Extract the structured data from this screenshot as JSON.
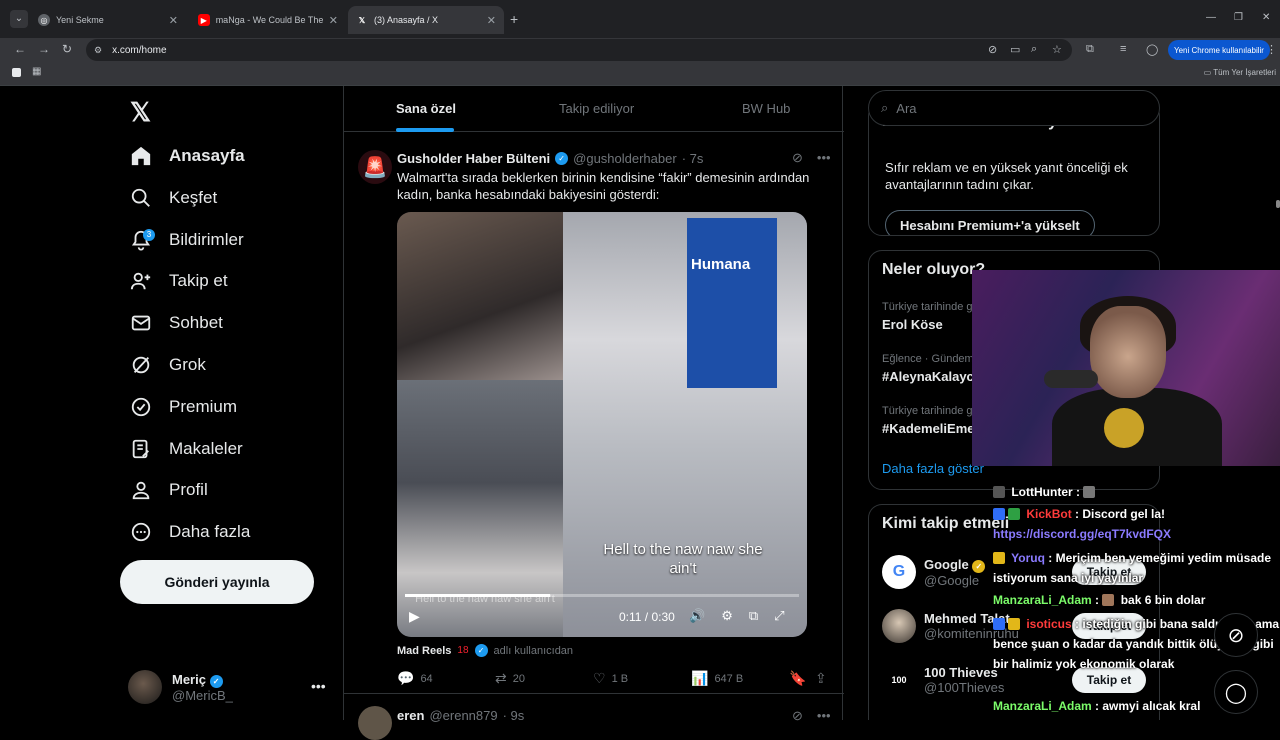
{
  "browser": {
    "tabs": [
      {
        "title": "Yeni Sekme"
      },
      {
        "title": "maNga - We Could Be The Sam"
      },
      {
        "title": "(3) Anasayfa / X"
      }
    ],
    "url": "x.com/home",
    "update_button": "Yeni Chrome kullanılabilir",
    "bookmarks_all": "Tüm Yer İşaretleri"
  },
  "nav": {
    "items": [
      {
        "label": "Anasayfa"
      },
      {
        "label": "Keşfet"
      },
      {
        "label": "Bildirimler",
        "badge": "3"
      },
      {
        "label": "Takip et"
      },
      {
        "label": "Sohbet"
      },
      {
        "label": "Grok"
      },
      {
        "label": "Premium"
      },
      {
        "label": "Makaleler"
      },
      {
        "label": "Profil"
      },
      {
        "label": "Daha fazla"
      }
    ],
    "post_button": "Gönderi yayınla",
    "account": {
      "name": "Meriç",
      "handle": "@MericB_"
    }
  },
  "timeline": {
    "tabs": [
      {
        "label": "Sana özel"
      },
      {
        "label": "Takip ediliyor"
      },
      {
        "label": "BW Hub"
      }
    ],
    "tweet": {
      "name": "Gusholder Haber Bülteni",
      "handle": "@gusholderhaber",
      "time": "· 7s",
      "text": "Walmart'ta sırada beklerken birinin kendisine “fakir” demesinin ardından kadın, banka hesabındaki bakiyesini gösterdi:",
      "video": {
        "brand_text": "Humana",
        "caption": "Hell to the naw naw she ain't",
        "time": "0:11 / 0:30",
        "progress": 0.367
      },
      "source": {
        "name": "Mad Reels",
        "age": "18",
        "sub": "adlı kullanıcıdan"
      },
      "stats": {
        "replies": "64",
        "reposts": "20",
        "likes": "1 B",
        "views": "647 B"
      }
    },
    "tweet2": {
      "name": "eren",
      "handle": "@erenn879",
      "time": "· 9s"
    }
  },
  "right": {
    "search_placeholder": "Ara",
    "premium": {
      "title": "Hesabını Premium+'a yükselt",
      "desc": "Sıfır reklam ve en yüksek yanıt önceliği ek avantajlarının tadını çıkar.",
      "button": "Hesabını Premium+'a yükselt"
    },
    "trends": {
      "title": "Neler oluyor?",
      "items": [
        {
          "context": "Türkiye tarihinde gündemde",
          "topic": "Erol Köse"
        },
        {
          "context": "Eğlence · Gündemde",
          "topic": "#AleynaKalaycı"
        },
        {
          "context": "Türkiye tarihinde gündemde",
          "topic": "#KademeliEmeklilik"
        }
      ],
      "more": "Daha fazla göster"
    },
    "who": {
      "title": "Kimi takip etmeli",
      "items": [
        {
          "name": "Google",
          "handle": "@Google"
        },
        {
          "name": "Mehmed Talat",
          "handle": "@komiteninruhu"
        },
        {
          "name": "100 Thieves",
          "handle": "@100Thieves"
        }
      ],
      "follow_label": "Takip et"
    }
  },
  "chat": {
    "messages": [
      {
        "user": "LottHunter",
        "text": "",
        "color": "#e7e9ea"
      },
      {
        "user": "KickBot",
        "text": "Discord gel la!",
        "color": "#ff3b3b"
      },
      {
        "user": "",
        "text": "https://discord.gg/eqT7kvdFQX",
        "color": "#8b7bff"
      },
      {
        "user": "Yoruq",
        "text": "Meriçim ben yemeğimi yedim müsade istiyorum sana iyi yayınlar",
        "color": "#8b7bff"
      },
      {
        "user": "ManzaraLi_Adam",
        "text": "bak 6 bin dolar",
        "color": "#7cfc6a"
      },
      {
        "user": "isoticus",
        "text": "istediğin gibi bana saldırabilir ama bence şuan o kadar da yandık bittik ölüyoruz gibi bir halimiz yok ekonomik olarak",
        "color": "#ff3b3b"
      },
      {
        "user": "ManzaraLi_Adam",
        "text": "awmyi alıcak kral",
        "color": "#7cfc6a"
      }
    ]
  },
  "colors": {
    "accent": "#1d9bf0",
    "background": "#000000",
    "text": "#e7e9ea",
    "muted": "#71767b",
    "border": "#2f3336"
  }
}
